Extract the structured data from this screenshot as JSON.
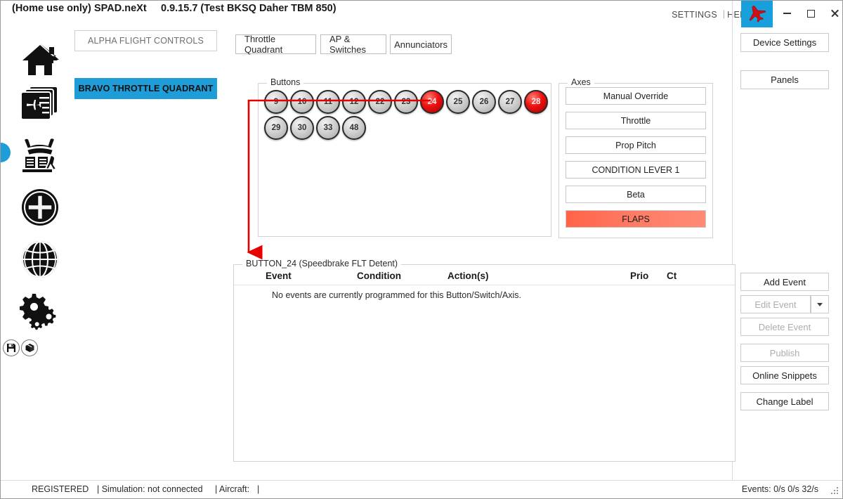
{
  "titlebar": {
    "home_use": "(Home use only)",
    "app_name": "SPAD.neXt",
    "version": "0.9.15.7 (Test BKSQ Daher TBM 850)",
    "settings": "SETTINGS",
    "separator": "|",
    "help": "HELP",
    "logo_icon": "airplane-icon",
    "logo_bg": "#17a0db",
    "minimize_icon": "minimize-icon",
    "maximize_icon": "maximize-icon",
    "close_icon": "close-icon"
  },
  "sidebar": {
    "items": [
      {
        "icon": "home-icon",
        "name": "home"
      },
      {
        "icon": "aircraft-profiles-icon",
        "name": "aircraft-profiles"
      },
      {
        "icon": "cockpit-hardware-icon",
        "name": "cockpit-hardware"
      },
      {
        "icon": "plus-circle-icon",
        "name": "add"
      },
      {
        "icon": "globe-icon",
        "name": "community"
      },
      {
        "icon": "gears-icon",
        "name": "settings"
      }
    ],
    "save_icon": "save-icon",
    "package_icon": "package-icon",
    "active_index": 2
  },
  "devices": [
    {
      "label": "ALPHA FLIGHT CONTROLS",
      "selected": false
    },
    {
      "label": "BRAVO THROTTLE QUADRANT",
      "selected": true
    }
  ],
  "tabs": [
    {
      "label": "Throttle Quadrant",
      "active": true
    },
    {
      "label": "AP & Switches",
      "active": false
    },
    {
      "label": "Annunciators",
      "active": false
    }
  ],
  "panel_buttons": {
    "device_settings": "Device Settings",
    "panels": "Panels"
  },
  "buttons_group": {
    "label": "Buttons",
    "items": [
      {
        "id": "9",
        "active": false
      },
      {
        "id": "10",
        "active": false
      },
      {
        "id": "11",
        "active": false
      },
      {
        "id": "12",
        "active": false
      },
      {
        "id": "22",
        "active": false
      },
      {
        "id": "23",
        "active": false
      },
      {
        "id": "24",
        "active": true
      },
      {
        "id": "25",
        "active": false
      },
      {
        "id": "26",
        "active": false
      },
      {
        "id": "27",
        "active": false
      },
      {
        "id": "28",
        "active": true
      },
      {
        "id": "29",
        "active": false
      },
      {
        "id": "30",
        "active": false
      },
      {
        "id": "33",
        "active": false
      },
      {
        "id": "48",
        "active": false
      }
    ]
  },
  "axes_group": {
    "label": "Axes",
    "items": [
      {
        "label": "Manual Override",
        "active": false
      },
      {
        "label": "Throttle",
        "active": false
      },
      {
        "label": "Prop Pitch",
        "active": false
      },
      {
        "label": "CONDITION LEVER 1",
        "active": false
      },
      {
        "label": "Beta",
        "active": false
      },
      {
        "label": "FLAPS",
        "active": true
      }
    ],
    "active_color": "#ff6347"
  },
  "events_group": {
    "label": "BUTTON_24 (Speedbrake FLT Detent)",
    "columns": [
      "Event",
      "Condition",
      "Action(s)",
      "Prio",
      "Ct"
    ],
    "empty_message": "No events are currently programmed for this Button/Switch/Axis.",
    "rows": []
  },
  "actions": [
    {
      "label": "Add Event",
      "enabled": true
    },
    {
      "label": "Edit Event",
      "enabled": false
    },
    {
      "label": "Delete Event",
      "enabled": false
    },
    {
      "label": "Publish",
      "enabled": false
    },
    {
      "label": "Online Snippets",
      "enabled": true
    },
    {
      "label": "Change Label",
      "enabled": true
    }
  ],
  "edit_dropdown_icon": "chevron-down-icon",
  "annotation": {
    "color": "#e60000",
    "shape": "elbow-arrow-from-button-24-to-events-label"
  },
  "statusbar": {
    "registered": "REGISTERED",
    "simulation": "| Simulation: not connected",
    "aircraft_label": "| Aircraft:",
    "aircraft_value": "|",
    "events": "Events: 0/s 0/s 32/s",
    "grip_icon": "resize-grip-icon"
  }
}
